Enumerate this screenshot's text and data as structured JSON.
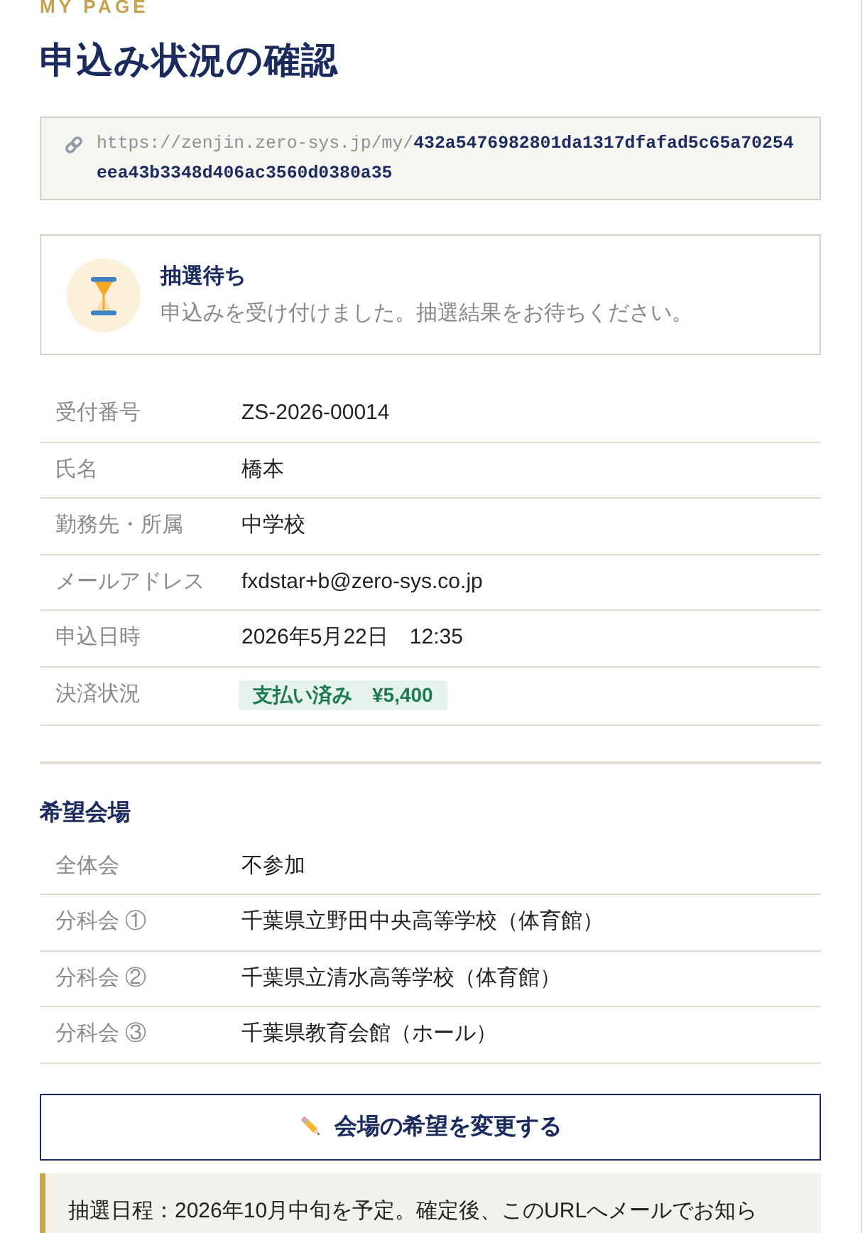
{
  "header": {
    "eyebrow": "MY PAGE",
    "title": "申込み状況の確認"
  },
  "url": {
    "text": "https://zenjin.zero-sys.jp/my/**432a5476982801da1317dfafad5c65a70254eea43b3348d406ac3560d0380a35**"
  },
  "status": {
    "kind": "waiting",
    "title": "抽選待ち",
    "message": "申込みを受け付けました。抽選結果をお待ちください。"
  },
  "details": [
    {
      "label": "受付番号",
      "value": "ZS-2026-00014",
      "kind": "text"
    },
    {
      "label": "氏名",
      "value": "橋本",
      "kind": "text"
    },
    {
      "label": "勤務先・所属",
      "value": "中学校",
      "kind": "text"
    },
    {
      "label": "メールアドレス",
      "value": "fxdstar+b@zero-sys.co.jp",
      "kind": "text"
    },
    {
      "label": "申込日時",
      "value": "2026年5月22日　12:35",
      "kind": "text"
    },
    {
      "label": "決済状況",
      "value": "支払い済み　¥5,400",
      "kind": "badge"
    }
  ],
  "venues": {
    "title": "希望会場",
    "rows": [
      {
        "label": "全体会",
        "value": "不参加"
      },
      {
        "label": "分科会 ①",
        "value": "千葉県立野田中央高等学校（体育館）"
      },
      {
        "label": "分科会 ②",
        "value": "千葉県立清水高等学校（体育館）"
      },
      {
        "label": "分科会 ③",
        "value": "千葉県教育会館（ホール）"
      }
    ]
  },
  "change_button": {
    "label": "会場の希望を変更する"
  },
  "note": {
    "text": "抽選日程：2026年10月中旬を予定。確定後、このURLへメールでお知ら"
  }
}
